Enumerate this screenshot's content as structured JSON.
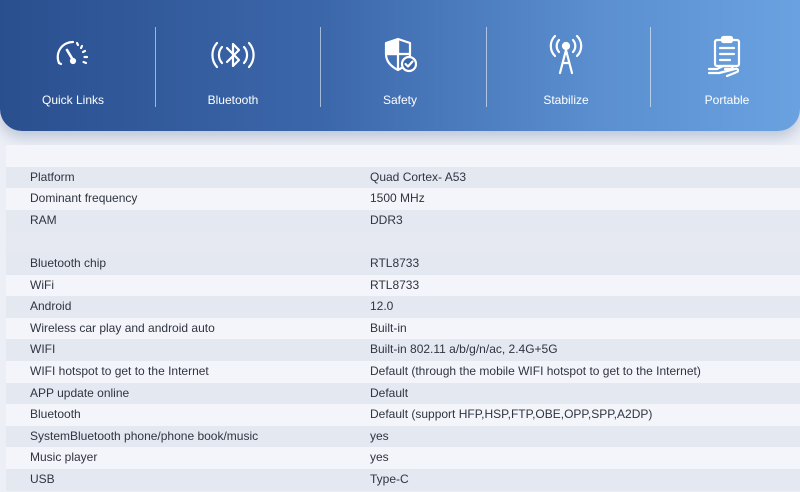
{
  "features": [
    {
      "label": "Quick Links",
      "icon": "speedometer-icon"
    },
    {
      "label": "Bluetooth",
      "icon": "bluetooth-icon"
    },
    {
      "label": "Safety",
      "icon": "shield-check-icon"
    },
    {
      "label": "Stabilize",
      "icon": "antenna-signal-icon"
    },
    {
      "label": "Portable",
      "icon": "clipboard-hand-icon"
    }
  ],
  "specs": [
    {
      "name": "",
      "value": ""
    },
    {
      "name": "Platform",
      "value": "Quad Cortex- A53"
    },
    {
      "name": "Dominant frequency",
      "value": "1500 MHz"
    },
    {
      "name": "RAM",
      "value": "DDR3"
    },
    {
      "name": "",
      "value": ""
    },
    {
      "name": "Bluetooth chip",
      "value": "RTL8733"
    },
    {
      "name": "WiFi",
      "value": "RTL8733"
    },
    {
      "name": "Android",
      "value": "12.0"
    },
    {
      "name": "Wireless car play and android auto",
      "value": "Built-in"
    },
    {
      "name": "WIFI",
      "value": "Built-in 802.11 a/b/g/n/ac, 2.4G+5G"
    },
    {
      "name": "WIFI hotspot to get to the Internet",
      "value": "Default (through the mobile WIFI hotspot to get to the Internet)"
    },
    {
      "name": "APP update online",
      "value": "Default"
    },
    {
      "name": "Bluetooth",
      "value": "Default (support HFP,HSP,FTP,OBE,OPP,SPP,A2DP)"
    },
    {
      "name": "SystemBluetooth phone/phone book/music",
      "value": "yes"
    },
    {
      "name": "Music player",
      "value": "yes"
    },
    {
      "name": "USB",
      "value": "Type-C"
    }
  ]
}
